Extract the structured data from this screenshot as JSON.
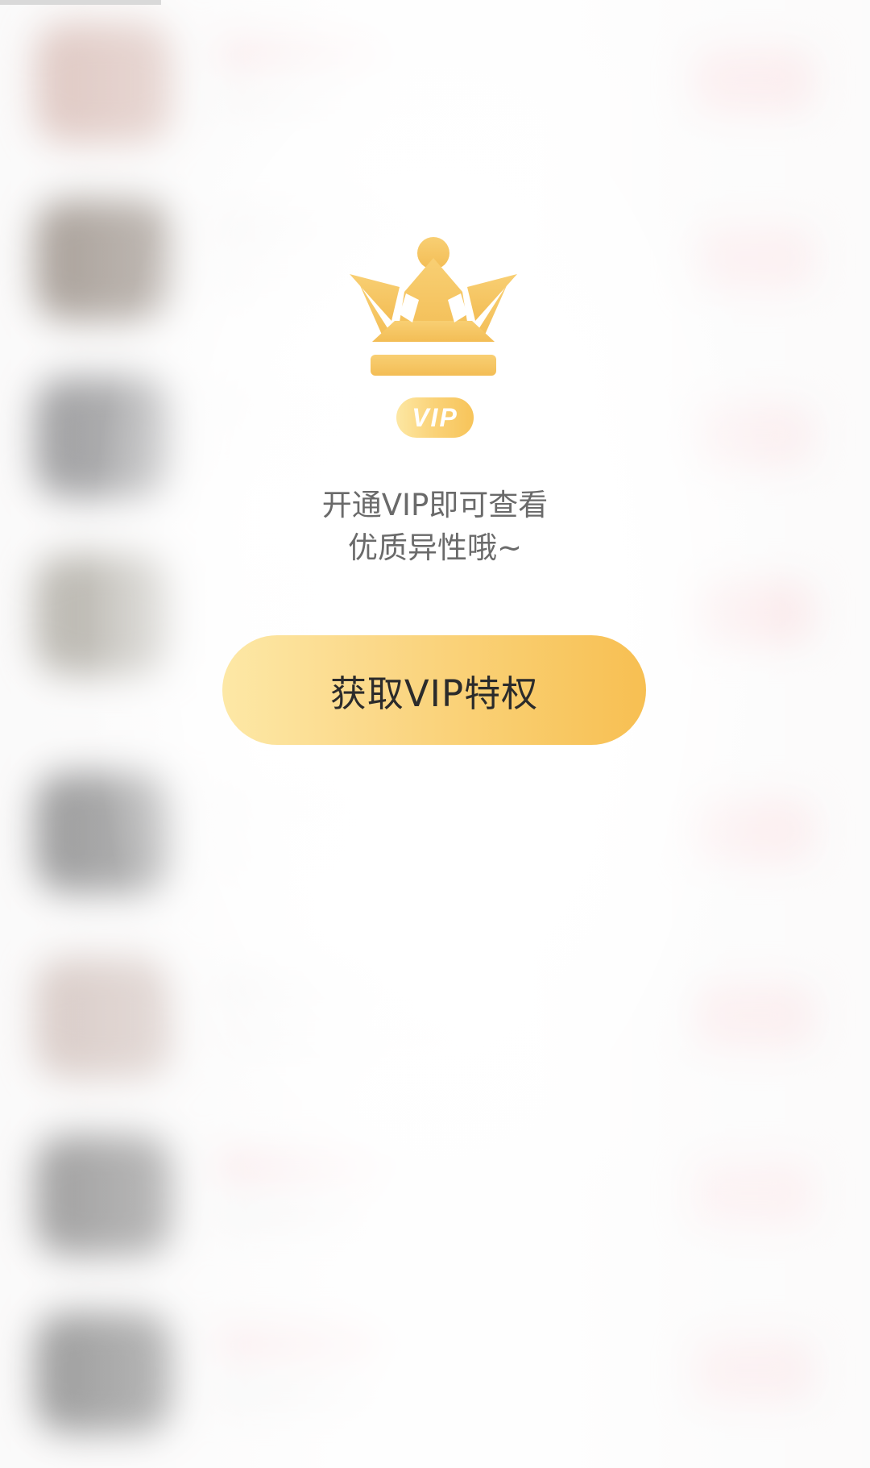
{
  "paywall": {
    "vip_badge": "VIP",
    "message_line1": "开通VIP即可查看",
    "message_line2": "优质异性哦~",
    "cta_label": "获取VIP特权"
  },
  "icons": {
    "crown": "crown-icon",
    "vip_badge": "vip-badge"
  },
  "colors": {
    "gold_light": "#fde8a6",
    "gold_mid": "#f9cc6b",
    "gold_dark": "#f7bf52",
    "crown_gold": "#f6c766",
    "message_text": "#6a6a6a",
    "cta_text": "#2b2b2b"
  }
}
